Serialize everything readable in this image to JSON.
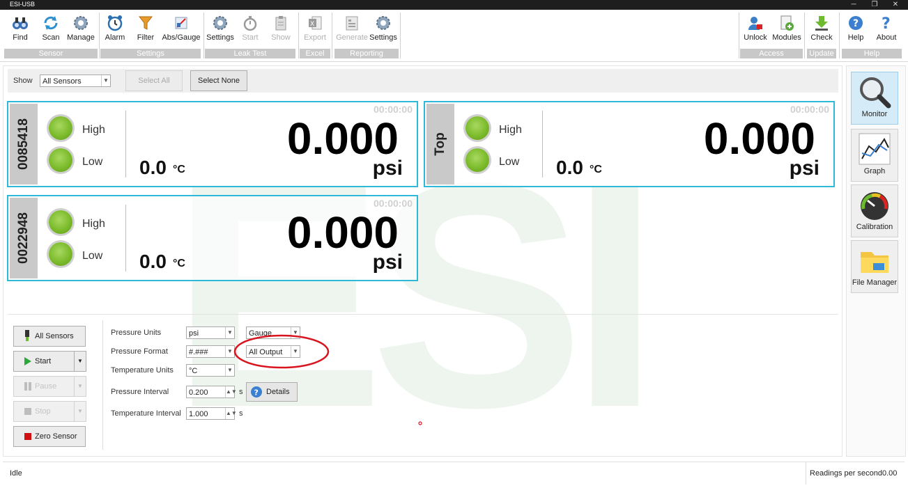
{
  "window": {
    "title": "ESI-USB",
    "min": "─",
    "restore": "❐",
    "close": "✕"
  },
  "ribbon": {
    "groups": [
      {
        "name": "Sensor",
        "buttons": [
          "Find",
          "Scan",
          "Manage"
        ]
      },
      {
        "name": "Settings",
        "buttons": [
          "Alarm",
          "Filter",
          "Abs/Gauge"
        ]
      },
      {
        "name": "Leak Test",
        "buttons": [
          "Settings",
          "Start",
          "Show"
        ]
      },
      {
        "name": "Excel",
        "buttons": [
          "Export"
        ]
      },
      {
        "name": "Reporting",
        "buttons": [
          "Generate",
          "Settings"
        ]
      },
      {
        "name": "Access",
        "buttons": [
          "Unlock",
          "Modules"
        ]
      },
      {
        "name": "Update",
        "buttons": [
          "Check"
        ]
      },
      {
        "name": "Help",
        "buttons": [
          "Help",
          "About"
        ]
      }
    ]
  },
  "showbar": {
    "label": "Show",
    "select_value": "All Sensors",
    "select_all": "Select All",
    "select_none": "Select None"
  },
  "sensors": [
    {
      "id": "0085418",
      "high": "High",
      "low": "Low",
      "time": "00:00:00",
      "value": "0.000",
      "unit": "psi",
      "temp": "0.0",
      "temp_unit": "°C"
    },
    {
      "id": "Top",
      "high": "High",
      "low": "Low",
      "time": "00:00:00",
      "value": "0.000",
      "unit": "psi",
      "temp": "0.0",
      "temp_unit": "°C"
    },
    {
      "id": "0022948",
      "high": "High",
      "low": "Low",
      "time": "00:00:00",
      "value": "0.000",
      "unit": "psi",
      "temp": "0.0",
      "temp_unit": "°C"
    }
  ],
  "controls": {
    "all_sensors": "All Sensors",
    "start": "Start",
    "pause": "Pause",
    "stop": "Stop",
    "zero": "Zero Sensor"
  },
  "form": {
    "pressure_units_label": "Pressure Units",
    "pressure_units": "psi",
    "gauge": "Gauge",
    "pressure_format_label": "Pressure Format",
    "pressure_format": "#.###",
    "output": "All Output",
    "temp_units_label": "Temperature Units",
    "temp_units": "°C",
    "pressure_interval_label": "Pressure Interval",
    "pressure_interval": "0.200",
    "s1": "s",
    "details": "Details",
    "temp_interval_label": "Temperature Interval",
    "temp_interval": "1.000",
    "s2": "s"
  },
  "sidebar": [
    "Monitor",
    "Graph",
    "Calibration",
    "File Manager"
  ],
  "status": {
    "state": "Idle",
    "rps_label": "Readings per second",
    "rps": "0.00"
  },
  "colors": {
    "sensor_border": "#2fb9d8",
    "led": "#7cbb2c",
    "annotation": "#d9141e"
  }
}
